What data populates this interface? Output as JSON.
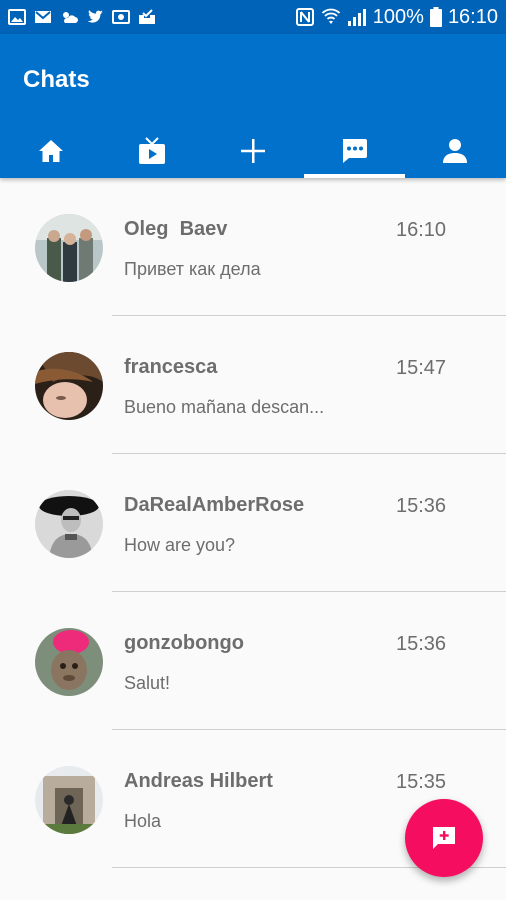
{
  "status_bar": {
    "battery": "100%",
    "time": "16:10",
    "icons": [
      "gallery-icon",
      "gmail-icon",
      "weather-icon",
      "twitter-icon",
      "cast-icon",
      "inbox-icon",
      "nfc-icon",
      "wifi-icon",
      "signal-icon",
      "battery-icon"
    ]
  },
  "header": {
    "title": "Chats"
  },
  "tabs": [
    {
      "icon": "home-icon",
      "active": false
    },
    {
      "icon": "tv-icon",
      "active": false
    },
    {
      "icon": "plus-icon",
      "active": false
    },
    {
      "icon": "chat-icon",
      "active": true
    },
    {
      "icon": "person-icon",
      "active": false
    }
  ],
  "chats": [
    {
      "name": "Oleg  Baev",
      "time": "16:10",
      "preview": "Привет как дела"
    },
    {
      "name": "francesca",
      "time": "15:47",
      "preview": "Bueno mañana descan..."
    },
    {
      "name": "DaRealAmberRose",
      "time": "15:36",
      "preview": "How are you?"
    },
    {
      "name": "gonzobongo",
      "time": "15:36",
      "preview": "Salut!"
    },
    {
      "name": "Andreas Hilbert",
      "time": "15:35",
      "preview": "Hola"
    }
  ],
  "fab": {
    "icon": "new-message-icon"
  },
  "colors": {
    "primary": "#0271cc",
    "status_bar": "#0063b8",
    "accent": "#f50d60",
    "text": "#6d6d6d"
  }
}
